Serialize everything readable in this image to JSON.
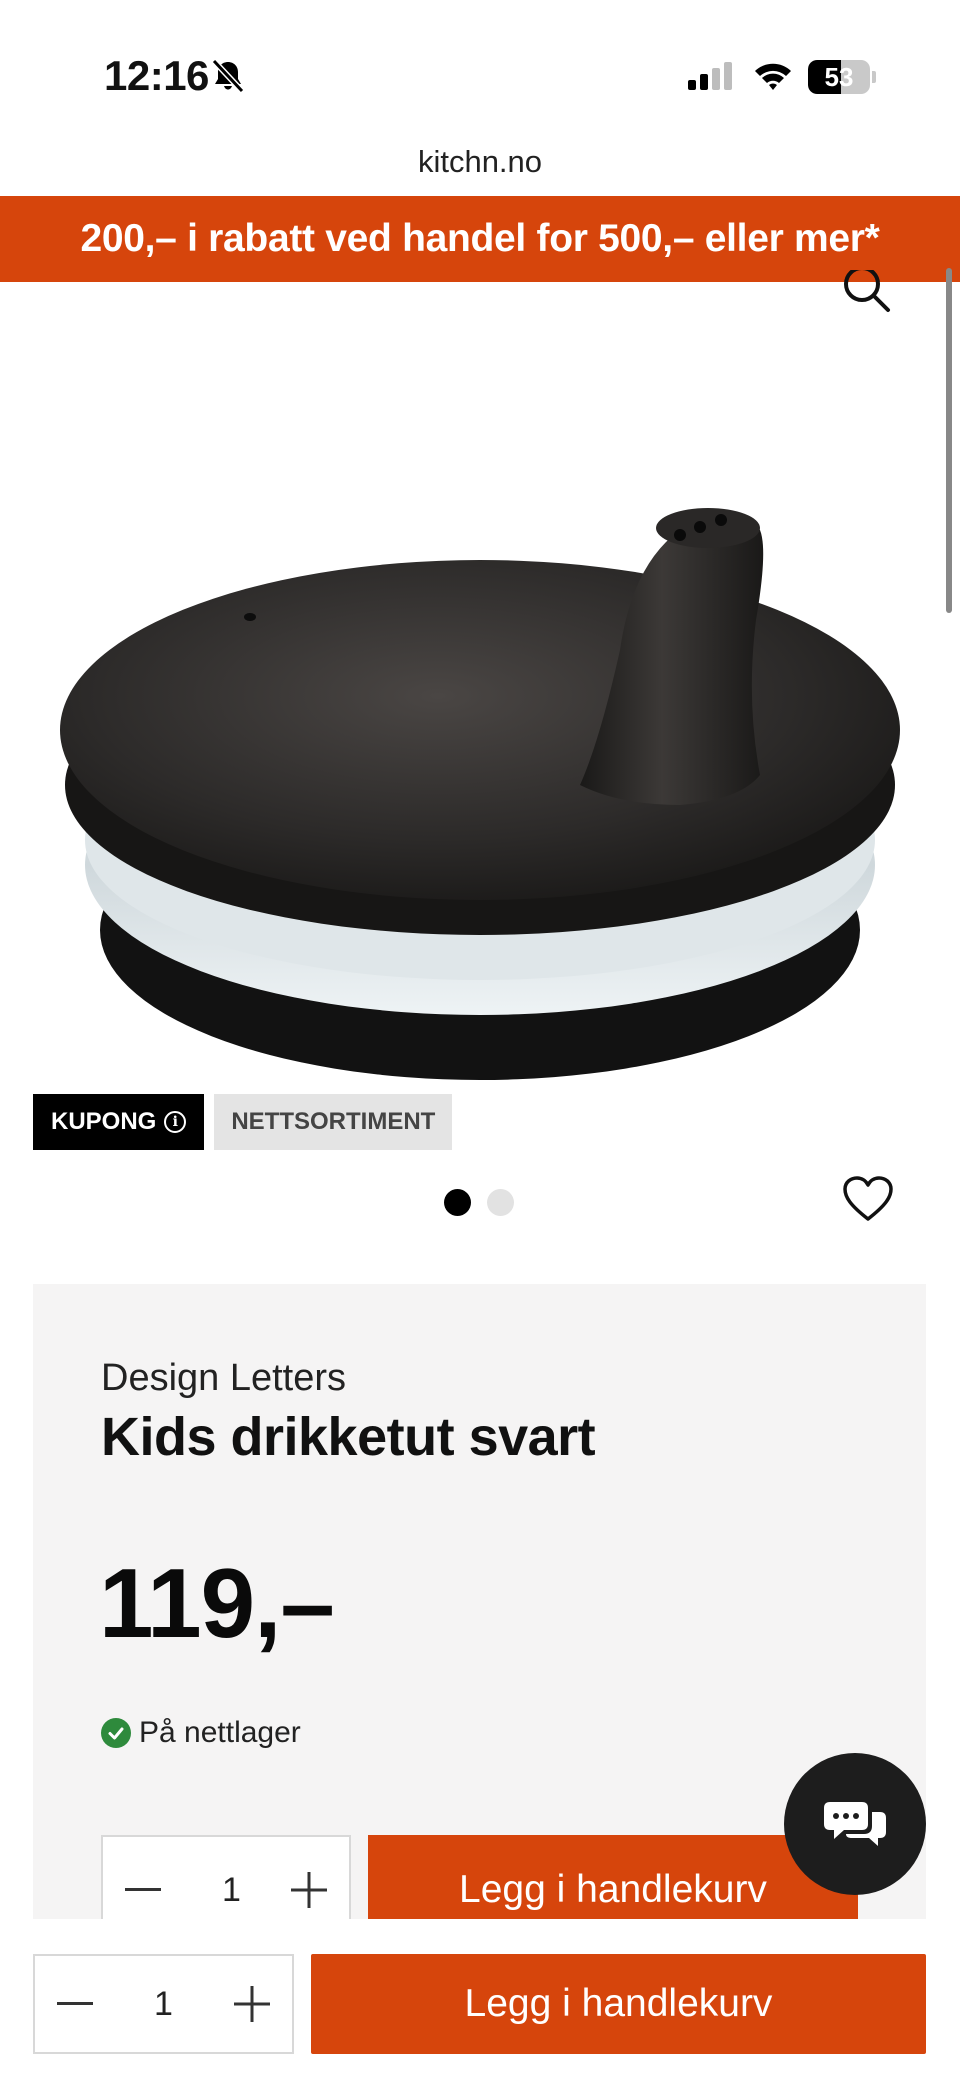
{
  "status_bar": {
    "time": "12:16",
    "battery": "53",
    "battery_level": 0.53
  },
  "browser": {
    "url": "kitchn.no"
  },
  "promo_banner": {
    "text": "200,– i rabatt ved handel for 500,– eller mer*"
  },
  "icons": {
    "search": "search-icon",
    "heart": "heart-icon",
    "chat": "chat-icon",
    "mute": "bell-slash-icon"
  },
  "badges": {
    "coupon": "KUPONG",
    "online": "NETTSORTIMENT"
  },
  "carousel": {
    "total": 2,
    "active": 1
  },
  "product": {
    "brand": "Design Letters",
    "name": "Kids drikketut svart",
    "price": "119,–",
    "stock": "På nettlager"
  },
  "cart": {
    "quantity": "1",
    "add_label": "Legg i handlekurv"
  },
  "colors": {
    "accent": "#d6450c",
    "stock_green": "#2e8a3c",
    "panel_bg": "#f5f4f4"
  }
}
